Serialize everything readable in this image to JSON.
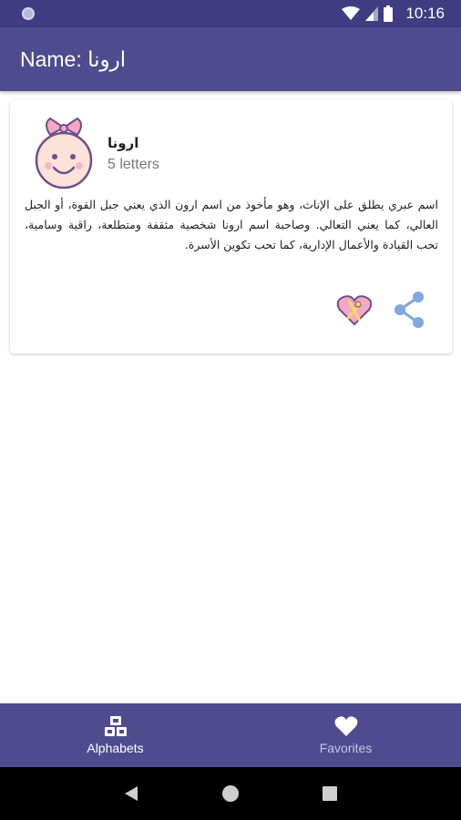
{
  "status_bar": {
    "time": "10:16",
    "icons": [
      "notification-dot-icon",
      "wifi-icon",
      "signal-icon",
      "battery-icon"
    ]
  },
  "app_bar": {
    "title": "Name: ارونا"
  },
  "card": {
    "name": "ارونا",
    "letters": "5 letters",
    "description": "اسم عبري يطلق على الإناث، وهو مأخوذ من اسم ارون الذي يعني جبل القوة، أو الجبل العالي، كما يعني التعالي. وصاحبة اسم ارونا شخصية مثقفة ومتطلعة، راقية وسامية، تحب القيادة والأعمال الإدارية، كما تحب تكوين الأسرة.",
    "avatar_icon": "baby-girl-icon",
    "favorite_icon": "heart-gift-icon",
    "share_icon": "share-icon"
  },
  "bottom_nav": {
    "items": [
      {
        "label": "Alphabets",
        "icon": "blocks-icon",
        "active": true
      },
      {
        "label": "Favorites",
        "icon": "heart-icon",
        "active": false
      }
    ]
  },
  "colors": {
    "status_bar": "#413c82",
    "app_bar": "#4f4b8f",
    "accent_pink": "#f4a8c4",
    "share_blue": "#7fa8de"
  }
}
